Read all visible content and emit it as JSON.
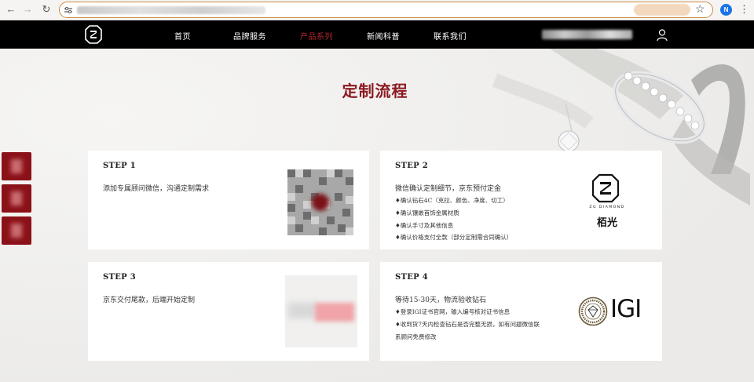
{
  "browser": {
    "back_icon": "arrow-left-icon",
    "forward_icon": "arrow-right-icon",
    "reload_icon": "reload-icon",
    "profile_initial": "N"
  },
  "header": {
    "logo": "zg-diamond-logo-icon",
    "nav": [
      "首页",
      "品牌服务",
      "产品系列",
      "新闻科普",
      "联系我们"
    ],
    "active_index": 2,
    "active_color": "#b3262d"
  },
  "section": {
    "title": "定制流程",
    "title_color": "#8c1a22"
  },
  "steps": [
    {
      "title": "STEP 1",
      "main": "添加专属顾问微信，沟通定制需求",
      "bullets": []
    },
    {
      "title": "STEP 2",
      "main": "微信确认定制细节，京东预付定金",
      "bullets": [
        "♦确认钻石4C（克拉、颜色、净度、切工）",
        "♦确认镶嵌首饰金属材质",
        "♦确认手寸及其他信息",
        "♦确认价格支付全款（部分定制需合同确认）"
      ]
    },
    {
      "title": "STEP 3",
      "main": "京东交付尾款，后端开始定制",
      "bullets": []
    },
    {
      "title": "STEP 4",
      "main": "等待15-30天，物流验收钻石",
      "bullets": [
        "♦登录IGI证书官网，输入编号核对证书信息",
        "♦收到货7天内检查钻石是否完整无损，如有问题微信联",
        "系顾问免费修改"
      ]
    }
  ],
  "brand": {
    "en": "ZG DIAMOND",
    "cn": "栢光"
  },
  "igi": {
    "label": "IGI"
  }
}
